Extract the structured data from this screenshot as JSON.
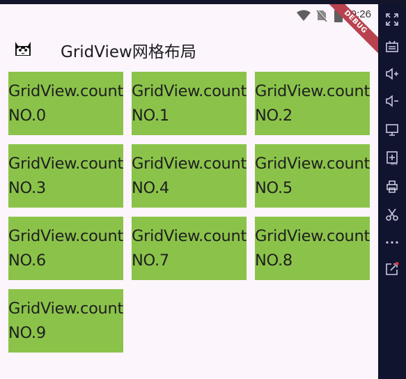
{
  "status_bar": {
    "time": "9:26",
    "icons": [
      "wifi-icon",
      "no-sim-icon",
      "battery-icon"
    ]
  },
  "debug_banner": {
    "label": "DEBUG",
    "color": "#b9424e"
  },
  "app_bar": {
    "title": "GridView网格布局",
    "logo": "cat-logo-icon"
  },
  "grid": {
    "item_color": "#8bc34a",
    "items": [
      "GridView.count NO.0",
      "GridView.count NO.1",
      "GridView.count NO.2",
      "GridView.count NO.3",
      "GridView.count NO.4",
      "GridView.count NO.5",
      "GridView.count NO.6",
      "GridView.count NO.7",
      "GridView.count NO.8",
      "GridView.count NO.9"
    ]
  },
  "emulator_toolbar": {
    "tools": [
      "fullscreen-icon",
      "keyboard-icon",
      "volume-up-icon",
      "volume-down-icon",
      "screen-icon",
      "install-apk-icon",
      "printer-icon",
      "cut-icon",
      "more-icon",
      "external-link-icon"
    ]
  }
}
